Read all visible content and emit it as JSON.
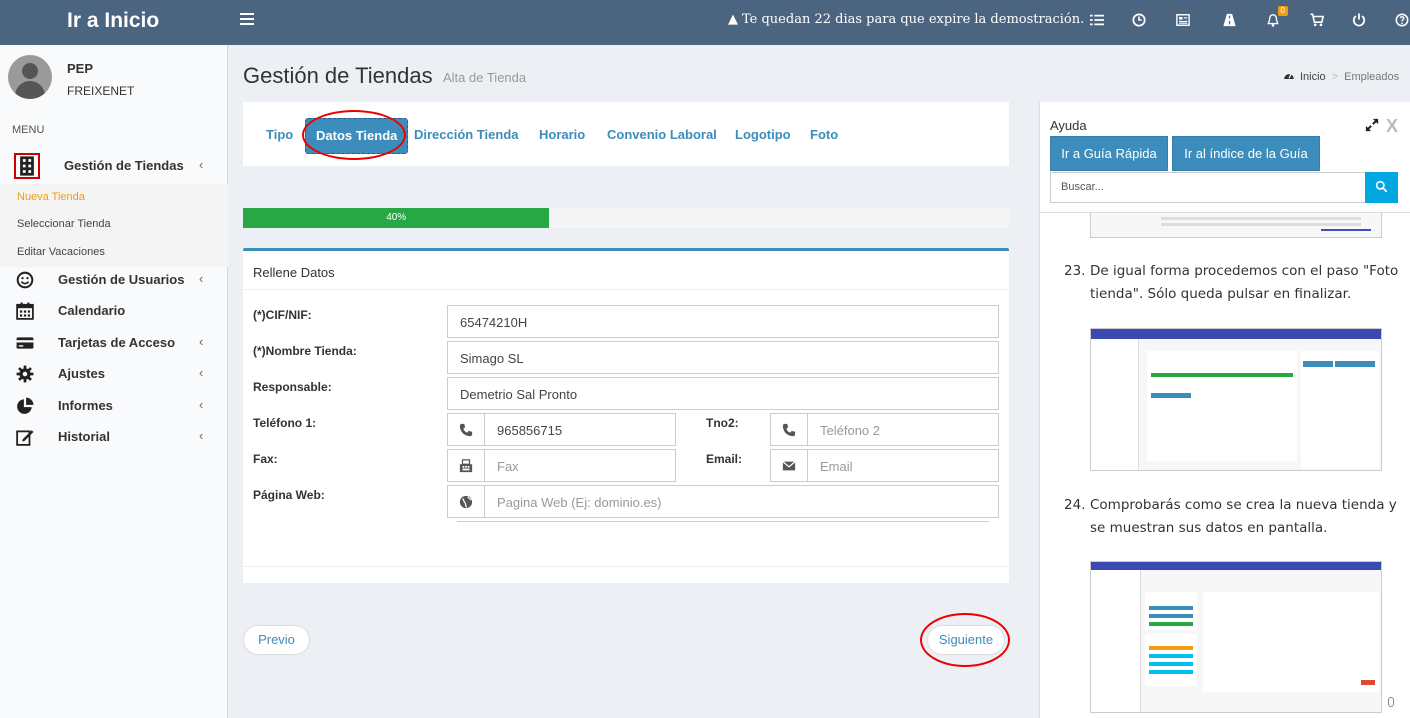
{
  "topbar": {
    "brand": "Ir a Inicio",
    "demo_message": "Te quedan 22 dias para que expire la demostración.",
    "notification_count": "0",
    "icons": [
      "list-icon",
      "clock-icon",
      "newspaper-icon",
      "road-icon",
      "bell-icon",
      "cart-icon",
      "power-icon",
      "help-icon"
    ]
  },
  "user": {
    "name": "PEP",
    "company": "FREIXENET"
  },
  "sidebar": {
    "menu_header": "MENU",
    "items": [
      {
        "label": "Gestión de Tiendas",
        "icon": "building-icon"
      },
      {
        "label": "Gestión de Usuarios",
        "icon": "smile-icon"
      },
      {
        "label": "Calendario",
        "icon": "calendar-icon"
      },
      {
        "label": "Tarjetas de Acceso",
        "icon": "credit-card-icon"
      },
      {
        "label": "Ajustes",
        "icon": "gear-icon"
      },
      {
        "label": "Informes",
        "icon": "pie-chart-icon"
      },
      {
        "label": "Historial",
        "icon": "edit-icon"
      }
    ],
    "submenu": [
      "Nueva Tienda",
      "Seleccionar Tienda",
      "Editar Vacaciones"
    ]
  },
  "page": {
    "title": "Gestión de Tiendas",
    "subtitle": "Alta de Tienda",
    "breadcrumb": {
      "home": "Inicio",
      "current": "Empleados"
    }
  },
  "tabs": [
    "Tipo",
    "Datos Tienda",
    "Dirección Tienda",
    "Horario",
    "Convenio Laboral",
    "Logotipo",
    "Foto"
  ],
  "active_tab": "Datos Tienda",
  "progress": {
    "label": "40%",
    "percent": 40
  },
  "form": {
    "title": "Rellene Datos",
    "labels": {
      "cif": "(*)CIF/NIF:",
      "nombre": "(*)Nombre Tienda:",
      "responsable": "Responsable:",
      "telefono1": "Teléfono 1:",
      "tno2": "Tno2:",
      "fax": "Fax:",
      "email": "Email:",
      "web": "Página Web:"
    },
    "values": {
      "cif": "65474210H",
      "nombre": "Simago SL",
      "responsable": "Demetrio Sal Pronto",
      "telefono1": "965856715"
    },
    "placeholders": {
      "telefono2": "Teléfono 2",
      "fax": "Fax",
      "email": "Email",
      "web": "Pagina Web (Ej: dominio.es)"
    }
  },
  "nav": {
    "prev": "Previo",
    "next": "Siguiente"
  },
  "help": {
    "title": "Ayuda",
    "close": "X",
    "quick_guide": "Ir a Guía Rápida",
    "index_guide": "Ir al índice de la Guía",
    "search_placeholder": "Buscar...",
    "steps": [
      {
        "num": "23.",
        "line1": "De igual forma procedemos con el paso \"Foto",
        "line2": "tienda\". Sólo queda pulsar en finalizar."
      },
      {
        "num": "24.",
        "line1": "Comprobarás como se crea la nueva tienda y",
        "line2": "se muestran sus datos en pantalla."
      }
    ]
  },
  "colors": {
    "topbar": "#4b6580",
    "accent": "#3c8dbc",
    "progress": "#28a745",
    "highlight": "#e00000",
    "active_submenu": "#f39c12"
  }
}
